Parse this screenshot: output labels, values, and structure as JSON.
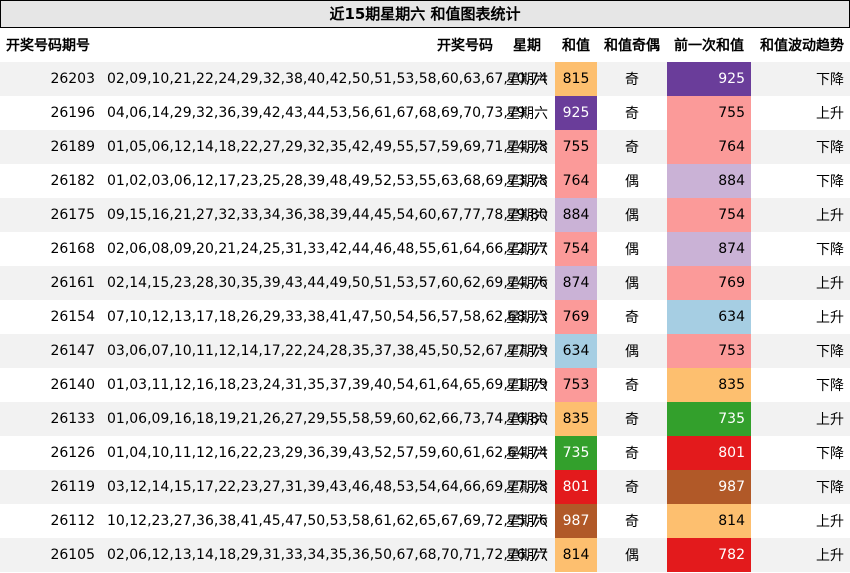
{
  "title": "近15期星期六 和值图表统计",
  "headers": {
    "issue": "开奖号码期号",
    "numbers": "开奖号码",
    "weekday": "星期",
    "sum": "和值",
    "parity": "和值奇偶",
    "prev_sum": "前一次和值",
    "trend": "和值波动趋势"
  },
  "colors": {
    "purple": "#6a3d9a",
    "light_purple": "#cab2d6",
    "pink": "#fb9a99",
    "light_blue": "#a6cee3",
    "orange": "#fdbf6f",
    "green": "#33a02c",
    "red": "#e31a1c",
    "brown": "#b15928"
  },
  "rows": [
    {
      "issue": "26203",
      "numbers": "02,09,10,21,22,24,29,32,38,40,42,50,51,53,58,60,63,67,70,74",
      "weekday": "星期六",
      "sum": "815",
      "sum_color": "#fdbf6f",
      "sum_text": "#000000",
      "parity": "奇",
      "prev_sum": "925",
      "prev_color": "#6a3d9a",
      "prev_text": "#ffffff",
      "trend": "下降"
    },
    {
      "issue": "26196",
      "numbers": "04,06,14,29,32,36,39,42,43,44,53,56,61,67,68,69,70,73,79",
      "weekday": "星期六",
      "sum": "925",
      "sum_color": "#6a3d9a",
      "sum_text": "#ffffff",
      "parity": "奇",
      "prev_sum": "755",
      "prev_color": "#fb9a99",
      "prev_text": "#000000",
      "trend": "上升"
    },
    {
      "issue": "26189",
      "numbers": "01,05,06,12,14,18,22,27,29,32,35,42,49,55,57,59,69,71,74,78",
      "weekday": "星期六",
      "sum": "755",
      "sum_color": "#fb9a99",
      "sum_text": "#000000",
      "parity": "奇",
      "prev_sum": "764",
      "prev_color": "#fb9a99",
      "prev_text": "#000000",
      "trend": "下降"
    },
    {
      "issue": "26182",
      "numbers": "01,02,03,06,12,17,23,25,28,39,48,49,52,53,55,63,68,69,73,78",
      "weekday": "星期六",
      "sum": "764",
      "sum_color": "#fb9a99",
      "sum_text": "#000000",
      "parity": "偶",
      "prev_sum": "884",
      "prev_color": "#cab2d6",
      "prev_text": "#000000",
      "trend": "下降"
    },
    {
      "issue": "26175",
      "numbers": "09,15,16,21,27,32,33,34,36,38,39,44,45,54,60,67,77,78,79,80",
      "weekday": "星期六",
      "sum": "884",
      "sum_color": "#cab2d6",
      "sum_text": "#000000",
      "parity": "偶",
      "prev_sum": "754",
      "prev_color": "#fb9a99",
      "prev_text": "#000000",
      "trend": "上升"
    },
    {
      "issue": "26168",
      "numbers": "02,06,08,09,20,21,24,25,31,33,42,44,46,48,55,61,64,66,72,77",
      "weekday": "星期六",
      "sum": "754",
      "sum_color": "#fb9a99",
      "sum_text": "#000000",
      "parity": "偶",
      "prev_sum": "874",
      "prev_color": "#cab2d6",
      "prev_text": "#000000",
      "trend": "下降"
    },
    {
      "issue": "26161",
      "numbers": "02,14,15,23,28,30,35,39,43,44,49,50,51,53,57,60,62,69,74,76",
      "weekday": "星期六",
      "sum": "874",
      "sum_color": "#cab2d6",
      "sum_text": "#000000",
      "parity": "偶",
      "prev_sum": "769",
      "prev_color": "#fb9a99",
      "prev_text": "#000000",
      "trend": "上升"
    },
    {
      "issue": "26154",
      "numbers": "07,10,12,13,17,18,26,29,33,38,41,47,50,54,56,57,58,62,68,73",
      "weekday": "星期六",
      "sum": "769",
      "sum_color": "#fb9a99",
      "sum_text": "#000000",
      "parity": "奇",
      "prev_sum": "634",
      "prev_color": "#a6cee3",
      "prev_text": "#000000",
      "trend": "上升"
    },
    {
      "issue": "26147",
      "numbers": "03,06,07,10,11,12,14,17,22,24,28,35,37,38,45,50,52,67,77,79",
      "weekday": "星期六",
      "sum": "634",
      "sum_color": "#a6cee3",
      "sum_text": "#000000",
      "parity": "偶",
      "prev_sum": "753",
      "prev_color": "#fb9a99",
      "prev_text": "#000000",
      "trend": "下降"
    },
    {
      "issue": "26140",
      "numbers": "01,03,11,12,16,18,23,24,31,35,37,39,40,54,61,64,65,69,71,79",
      "weekday": "星期六",
      "sum": "753",
      "sum_color": "#fb9a99",
      "sum_text": "#000000",
      "parity": "奇",
      "prev_sum": "835",
      "prev_color": "#fdbf6f",
      "prev_text": "#000000",
      "trend": "下降"
    },
    {
      "issue": "26133",
      "numbers": "01,06,09,16,18,19,21,26,27,29,55,58,59,60,62,66,73,74,76,80",
      "weekday": "星期六",
      "sum": "835",
      "sum_color": "#fdbf6f",
      "sum_text": "#000000",
      "parity": "奇",
      "prev_sum": "735",
      "prev_color": "#33a02c",
      "prev_text": "#ffffff",
      "trend": "上升"
    },
    {
      "issue": "26126",
      "numbers": "01,04,10,11,12,16,22,23,29,36,39,43,52,57,59,60,61,62,64,74",
      "weekday": "星期六",
      "sum": "735",
      "sum_color": "#33a02c",
      "sum_text": "#ffffff",
      "parity": "奇",
      "prev_sum": "801",
      "prev_color": "#e31a1c",
      "prev_text": "#ffffff",
      "trend": "下降"
    },
    {
      "issue": "26119",
      "numbers": "03,12,14,15,17,22,23,27,31,39,43,46,48,53,54,64,66,69,77,78",
      "weekday": "星期六",
      "sum": "801",
      "sum_color": "#e31a1c",
      "sum_text": "#ffffff",
      "parity": "奇",
      "prev_sum": "987",
      "prev_color": "#b15928",
      "prev_text": "#ffffff",
      "trend": "下降"
    },
    {
      "issue": "26112",
      "numbers": "10,12,23,27,36,38,41,45,47,50,53,58,61,62,65,67,69,72,75,76",
      "weekday": "星期六",
      "sum": "987",
      "sum_color": "#b15928",
      "sum_text": "#ffffff",
      "parity": "奇",
      "prev_sum": "814",
      "prev_color": "#fdbf6f",
      "prev_text": "#000000",
      "trend": "上升"
    },
    {
      "issue": "26105",
      "numbers": "02,06,12,13,14,18,29,31,33,34,35,36,50,67,68,70,71,72,76,77",
      "weekday": "星期六",
      "sum": "814",
      "sum_color": "#fdbf6f",
      "sum_text": "#000000",
      "parity": "偶",
      "prev_sum": "782",
      "prev_color": "#e31a1c",
      "prev_text": "#ffffff",
      "trend": "上升"
    }
  ]
}
